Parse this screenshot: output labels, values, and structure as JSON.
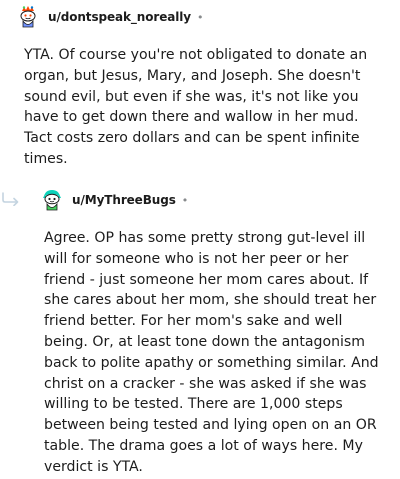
{
  "comments": [
    {
      "username": "u/dontspeak_noreally",
      "separator": "•",
      "avatar_icon": "snoo-avatar-icon",
      "body": "YTA. Of course you're not obligated to donate an organ, but Jesus, Mary, and Joseph. She doesn't sound evil, but even if she was, it's not like you have to get down there and wallow in her mud. Tact costs zero dollars and can be spent infinite times."
    },
    {
      "username": "u/MyThreeBugs",
      "separator": "•",
      "avatar_icon": "snoo-avatar-icon",
      "reply_icon": "reply-arrow-icon",
      "body": "Agree. OP has some pretty strong gut-level ill will for someone who is not her peer or her friend - just someone her mom cares about. If she cares about her mom, she should treat her friend better. For her mom's sake and well being. Or, at least tone down the antagonism back to polite apathy or something similar. And christ on a cracker - she was asked if she was willing to be tested. There are 1,000 steps between being tested and lying open on an OR table. The drama goes a lot of ways here. My verdict is YTA."
    }
  ],
  "colors": {
    "text": "#1c1c1c",
    "meta": "#878a8c",
    "reply_arrow": "#c4d4e0"
  }
}
